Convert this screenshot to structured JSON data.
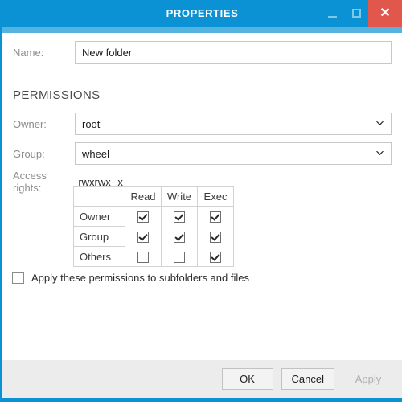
{
  "window": {
    "title": "PROPERTIES",
    "accent_color": "#0b92d4",
    "accent_light_color": "#55b3e0",
    "close_color": "#e2574c",
    "controls": {
      "minimize_label": "–",
      "maximize_label": "□",
      "close_label": "✕"
    }
  },
  "form": {
    "name_label": "Name:",
    "name_value": "New folder",
    "name_placeholder": "Name",
    "section_title": "PERMISSIONS",
    "owner_label": "Owner:",
    "owner_value": "root",
    "group_label": "Group:",
    "group_value": "wheel",
    "access_rights_label": "Access rights:",
    "access_rights_value": "-rwxrwx--x"
  },
  "permissions_table": {
    "corner_header": "",
    "columns": [
      "Read",
      "Write",
      "Exec"
    ],
    "rows": [
      {
        "label": "Owner",
        "values": [
          true,
          true,
          true
        ]
      },
      {
        "label": "Group",
        "values": [
          true,
          true,
          true
        ]
      },
      {
        "label": "Others",
        "values": [
          false,
          false,
          true
        ]
      }
    ]
  },
  "apply_recursive": {
    "label": "Apply these permissions to subfolders and files",
    "checked": false
  },
  "footer": {
    "ok_label": "OK",
    "cancel_label": "Cancel",
    "apply_label": "Apply",
    "apply_enabled": false
  }
}
